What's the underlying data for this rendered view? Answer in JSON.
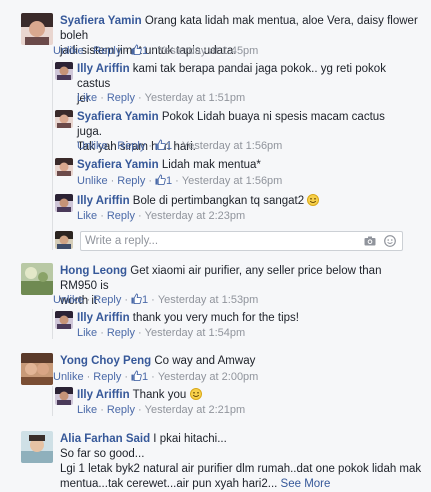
{
  "comments": [
    {
      "author": "Syafiera Yamin",
      "text_line1": " Orang kata lidah mak mentua, aloe Vera, daisy flower boleh",
      "text_line2": "jadi sistem jimat untuk tapis udara.",
      "like": "Unlike",
      "reply": "Reply",
      "likes": "1",
      "time": "Yesterday at 1:45pm",
      "replies": [
        {
          "author": "Illy Ariffin",
          "text_line1": " kami tak berapa pandai jaga pokok.. yg reti pokok castus",
          "text_line2": "jer",
          "like": "Like",
          "reply": "Reply",
          "likes": "",
          "time": "Yesterday at 1:51pm"
        },
        {
          "author": "Syafiera Yamin",
          "text_line1": " Pokok Lidah buaya ni spesis macam cactus juga.",
          "text_line2": "Tak yah siram hari hari.",
          "like": "Unlike",
          "reply": "Reply",
          "likes": "1",
          "time": "Yesterday at 1:56pm"
        },
        {
          "author": "Syafiera Yamin",
          "text_line1": " Lidah mak mentua*",
          "like": "Unlike",
          "reply": "Reply",
          "likes": "1",
          "time": "Yesterday at 1:56pm"
        },
        {
          "author": "Illy Ariffin",
          "text_line1": " Bole di pertimbangkan tq sangat2 ",
          "like": "Like",
          "reply": "Reply",
          "likes": "",
          "time": "Yesterday at 2:23pm"
        }
      ]
    },
    {
      "author": "Hong Leong",
      "text_line1": " Get xiaomi air purifier, any seller price below than RM950 is",
      "text_line2": "worth it",
      "like": "Unlike",
      "reply": "Reply",
      "likes": "1",
      "time": "Yesterday at 1:53pm",
      "replies": [
        {
          "author": "Illy Ariffin",
          "text_line1": " thank you very much for the tips!",
          "like": "Like",
          "reply": "Reply",
          "time": "Yesterday at 1:54pm"
        }
      ]
    },
    {
      "author": "Yong Choy Peng",
      "text_line1": " Co way and Amway",
      "like": "Unlike",
      "reply": "Reply",
      "likes": "1",
      "time": "Yesterday at 2:00pm",
      "replies": [
        {
          "author": "Illy Ariffin",
          "text_line1": " Thank you ",
          "like": "Like",
          "reply": "Reply",
          "time": "Yesterday at 2:21pm"
        }
      ]
    },
    {
      "author": "Alia Farhan Said",
      "text_line1": " I pkai hitachi...",
      "text_line2": "So far so good...",
      "text_line3": "Lgi 1 letak byk2 natural air purifier dlm rumah..dat one pokok lidah mak",
      "text_line4": "mentua...tak cerewet...air pun xyah hari2...",
      "see_more": "See More"
    }
  ],
  "reply_box": {
    "placeholder": "Write a reply..."
  },
  "colors": {
    "link": "#365899",
    "meta": "#90949c",
    "background": "#f6f7f9",
    "border": "#dddfe2"
  },
  "icons": [
    "thumbs-up-icon",
    "smiley-icon",
    "camera-icon",
    "sticker-icon"
  ]
}
